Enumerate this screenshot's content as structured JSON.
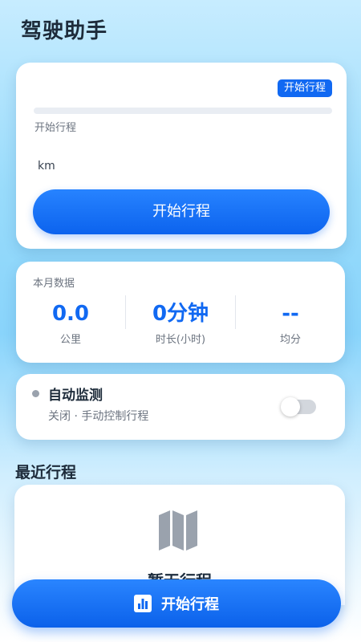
{
  "app": {
    "title": "驾驶助手"
  },
  "trip_card": {
    "status_chip": "开始行程",
    "progress_label": "开始行程",
    "progress_fraction": 0,
    "distance_unit": "km",
    "start_button_label": "开始行程"
  },
  "stats": {
    "title": "本月数据",
    "items": [
      {
        "value": "0.0",
        "label": "公里"
      },
      {
        "value": "0分钟",
        "label": "时长(小时)"
      },
      {
        "value": "--",
        "label": "均分"
      }
    ]
  },
  "auto_monitor": {
    "title": "自动监测",
    "description": "关闭 · 手动控制行程",
    "enabled": false
  },
  "recent": {
    "section_title": "最近行程",
    "empty_text": "暂无行程"
  },
  "fab": {
    "label": "开始行程"
  },
  "colors": {
    "accent": "#1169f2",
    "text_primary": "#1d2b3a",
    "text_secondary": "#6c7480",
    "icon_gray": "#9aa2ad"
  },
  "icons": {
    "map": "map-icon",
    "chart": "bar-chart-icon"
  }
}
